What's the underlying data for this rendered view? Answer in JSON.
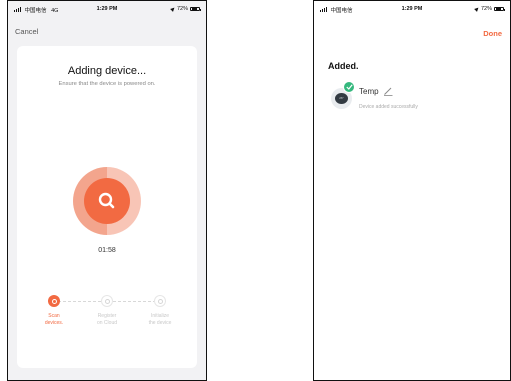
{
  "left": {
    "status": {
      "carrier": "中国电信",
      "network": "4G",
      "time": "1:29 PM",
      "battery": "72%"
    },
    "cancel_label": "Cancel",
    "title": "Adding device...",
    "subtitle": "Ensure that the device is powered on.",
    "timer": "01:58",
    "icons": {
      "scan": "search-icon"
    },
    "accent_color": "#f26a42",
    "steps": [
      {
        "label_line1": "Scan",
        "label_line2": "devices.",
        "active": true
      },
      {
        "label_line1": "Register",
        "label_line2": "on Cloud",
        "active": false
      },
      {
        "label_line1": "Initialize",
        "label_line2": "the device",
        "active": false
      }
    ]
  },
  "right": {
    "status": {
      "carrier": "中国电信",
      "time": "1:29 PM",
      "battery": "72%"
    },
    "done_label": "Done",
    "added_title": "Added.",
    "device": {
      "icon_text": "26°",
      "name": "Temp",
      "status": "Device added successfully",
      "check_color": "#35b87e"
    }
  }
}
